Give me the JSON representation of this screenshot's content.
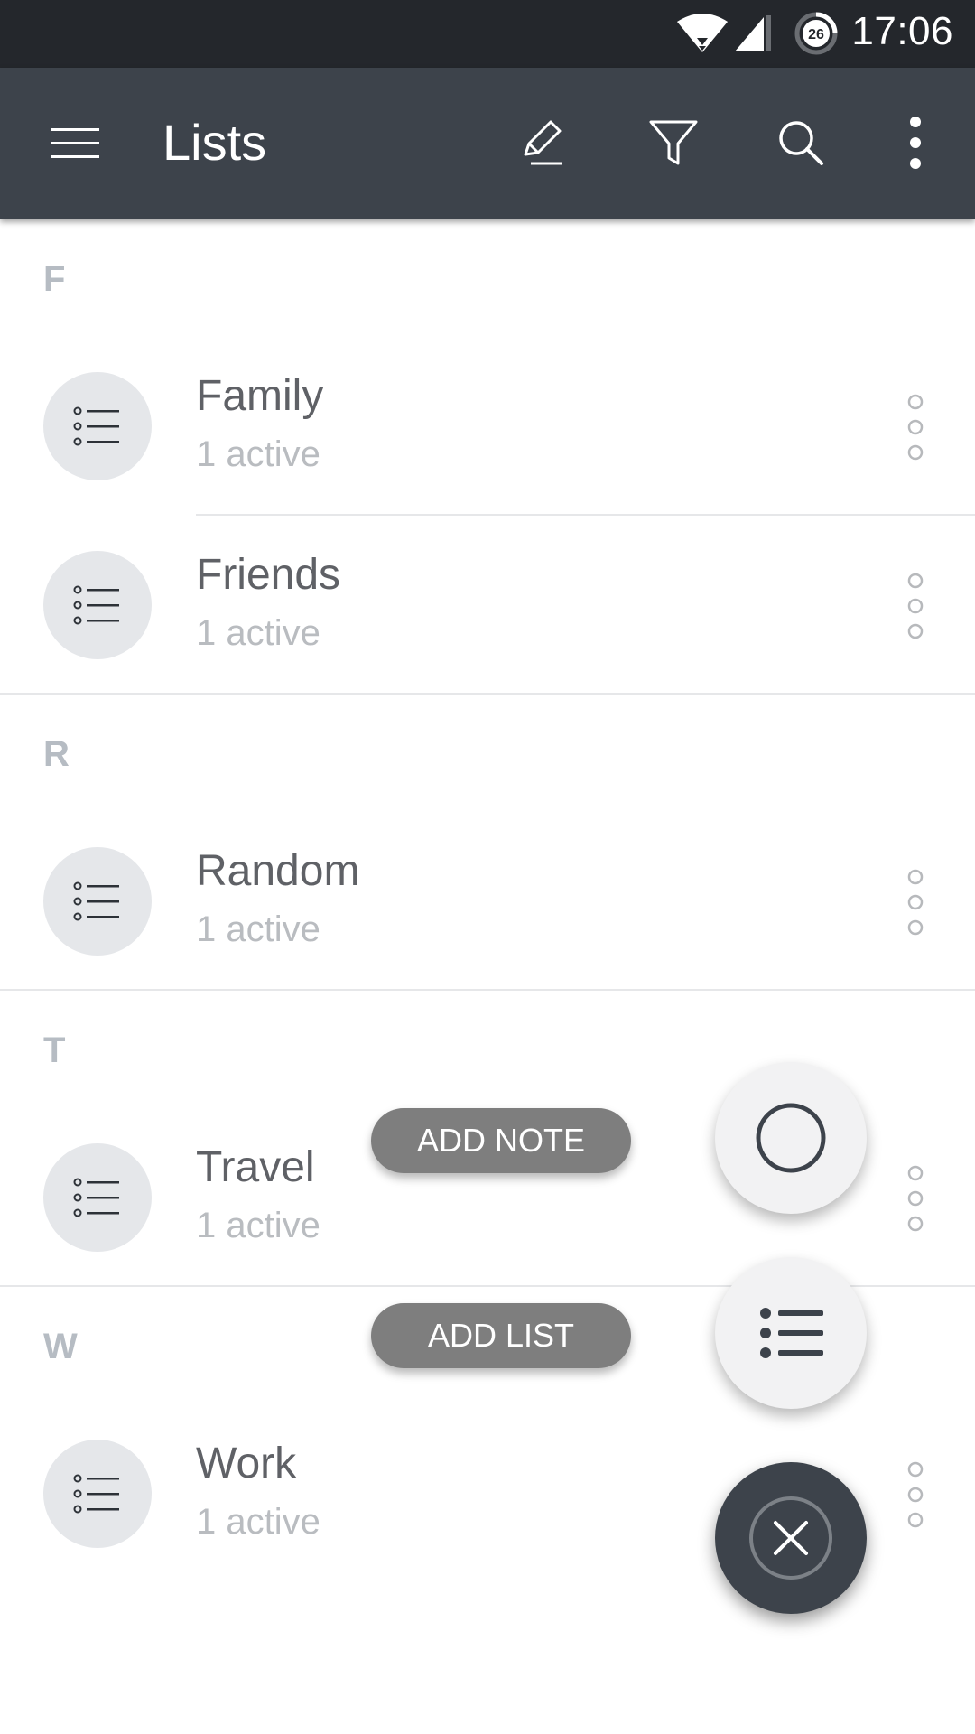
{
  "status_bar": {
    "time": "17:06",
    "battery_level_text": "26",
    "icons": [
      "wifi-icon",
      "signal-icon",
      "battery-icon"
    ]
  },
  "app_bar": {
    "title": "Lists",
    "actions": [
      "edit-icon",
      "filter-icon",
      "search-icon",
      "overflow-icon"
    ]
  },
  "sections": [
    {
      "letter": "F",
      "items": [
        {
          "title": "Family",
          "subtitle": "1 active"
        },
        {
          "title": "Friends",
          "subtitle": "1 active"
        }
      ]
    },
    {
      "letter": "R",
      "items": [
        {
          "title": "Random",
          "subtitle": "1 active"
        }
      ]
    },
    {
      "letter": "T",
      "items": [
        {
          "title": "Travel",
          "subtitle": "1 active"
        }
      ]
    },
    {
      "letter": "W",
      "items": [
        {
          "title": "Work",
          "subtitle": "1 active"
        }
      ]
    }
  ],
  "fab_menu": {
    "add_note_label": "ADD NOTE",
    "add_list_label": "ADD LIST"
  },
  "colors": {
    "status_bar": "#24272c",
    "app_bar": "#3d434b",
    "avatar_bg": "#e5e7ea",
    "section_letter": "#b6bcc3",
    "fab_label_bg": "#7e7e7e"
  }
}
